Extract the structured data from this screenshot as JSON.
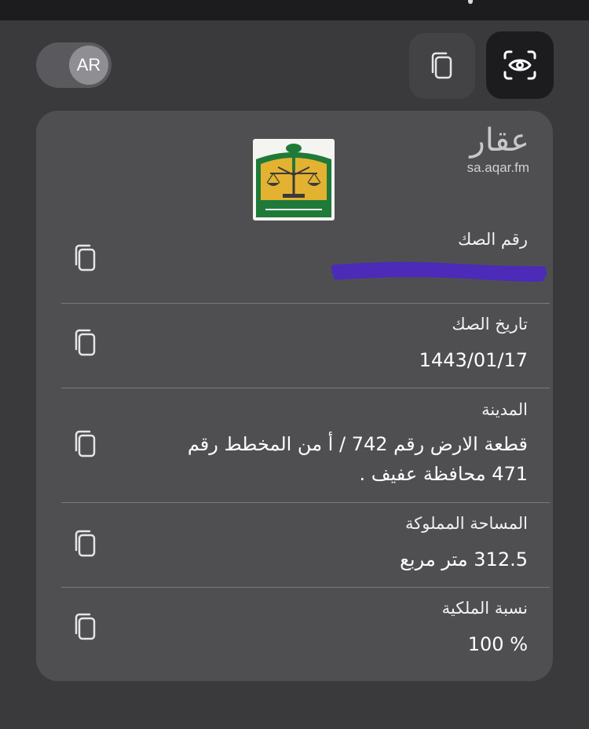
{
  "language_toggle": {
    "label": "AR"
  },
  "brand": {
    "name": "عقار",
    "url": "sa.aqar.fm"
  },
  "fields": [
    {
      "label": "رقم الصك",
      "value": ""
    },
    {
      "label": "تاريخ الصك",
      "value": "1443/01/17"
    },
    {
      "label": "المدينة",
      "value_line1": "قطعة الارض  رقم 742 / أ من المخطط رقم",
      "value_line2": "471  محافظة عفيف ."
    },
    {
      "label": "المساحة المملوكة",
      "value": "312.5 متر مربع"
    },
    {
      "label": "نسبة الملكية",
      "value": "100 %"
    }
  ],
  "colors": {
    "background": "#3a3a3c",
    "card": "#4f4f52",
    "emblem_green": "#1f7a3a",
    "emblem_gold": "#e3b230",
    "redaction": "#4b2bb8"
  },
  "icons": [
    "copy-icon",
    "scan-eye-icon",
    "ministry-of-justice-emblem"
  ]
}
